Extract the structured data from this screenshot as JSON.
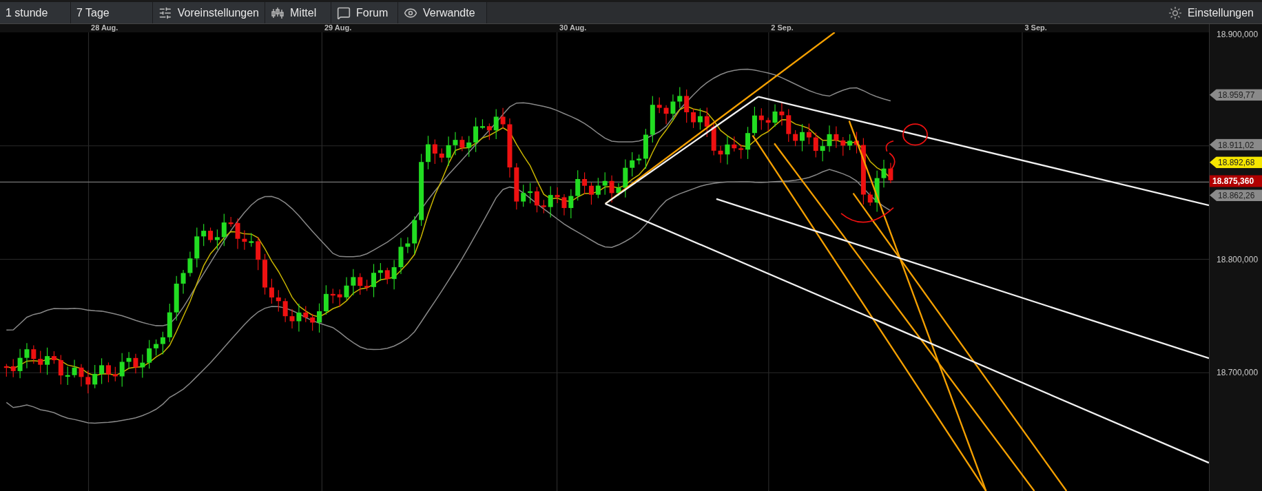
{
  "toolbar": {
    "items": [
      {
        "label": "1 stunde"
      },
      {
        "label": "7 Tage"
      },
      {
        "label": "Voreinstellungen"
      },
      {
        "label": "Mittel"
      },
      {
        "label": "Forum"
      },
      {
        "label": "Verwandte"
      }
    ],
    "settings": {
      "label": "Einstellungen"
    }
  },
  "chart": {
    "x_labels": [
      "28 Aug.",
      "29 Aug.",
      "30 Aug.",
      "2 Sep.",
      "3 Sep."
    ],
    "y_labels": [
      "18.900,000",
      "18.800,000",
      "18.700,000"
    ],
    "price_tags": [
      {
        "text": "18.959,77",
        "kind": "indicator"
      },
      {
        "text": "18.911,02",
        "kind": "indicator"
      },
      {
        "text": "18.892,68",
        "kind": "average"
      },
      {
        "text": "18.875,360",
        "kind": "last"
      },
      {
        "text": "18.862,26",
        "kind": "indicator"
      }
    ]
  }
}
